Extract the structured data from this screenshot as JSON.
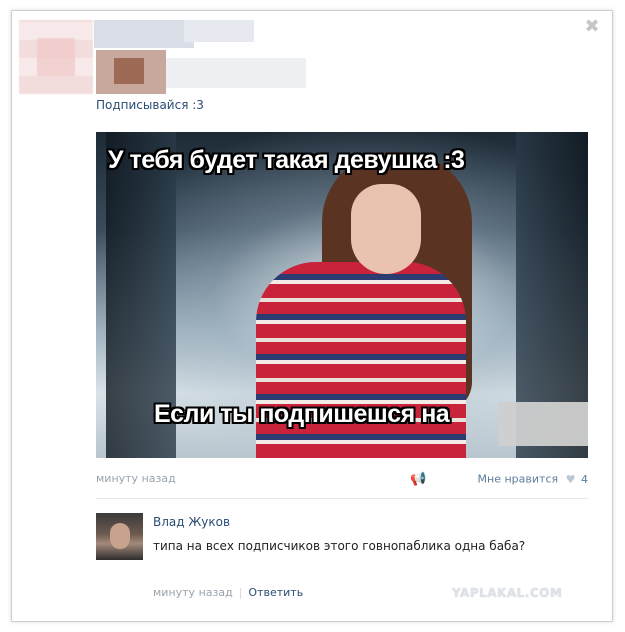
{
  "post": {
    "close_glyph": "✖",
    "text": "Подписывайся :3",
    "image": {
      "caption_top": "У тебя будет такая девушка :3",
      "caption_bottom": "Если ты подпишешся  на"
    },
    "time": "минуту назад",
    "like_label": "Мне нравится",
    "like_count": "4"
  },
  "comment": {
    "author": "Влад Жуков",
    "text": "типа на всех подписчиков этого говнопаблика одна баба?",
    "time": "минуту назад",
    "reply_label": "Ответить"
  },
  "watermark": "YAPLAKAL.COM",
  "colors": {
    "link": "#2b4c74",
    "meta": "#9aa3ad",
    "like": "#5c7c9e"
  }
}
